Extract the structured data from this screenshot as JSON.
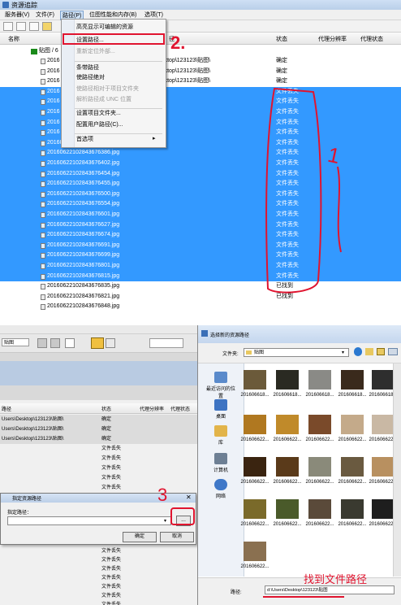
{
  "top_window": {
    "title": "资源追踪",
    "menu": [
      "服务器(V)",
      "文件(F)",
      "路径(P)",
      "位图性能和内存(B)",
      "选项(T)"
    ],
    "columns": {
      "name": "名称",
      "path": "径",
      "status": "状态",
      "proxy_res": "代理分辨率",
      "proxy_status": "代理状态"
    },
    "folder_row": "贴图 / 6",
    "rows": [
      {
        "name": "2016",
        "path": "sers\\Desktop\\123123\\贴图\\",
        "status": "确定",
        "sel": false
      },
      {
        "name": "2016",
        "path": "sers\\Desktop\\123123\\贴图\\",
        "status": "确定",
        "sel": false
      },
      {
        "name": "2016",
        "path": "sers\\Desktop\\123123\\贴图\\",
        "status": "确定",
        "sel": false
      },
      {
        "name": "2016",
        "path": "",
        "status": "文件丢失",
        "sel": true
      },
      {
        "name": "2016",
        "path": "",
        "status": "文件丢失",
        "sel": true
      },
      {
        "name": "2016",
        "path": "",
        "status": "文件丢失",
        "sel": true
      },
      {
        "name": "2016",
        "path": "",
        "status": "文件丢失",
        "sel": true
      },
      {
        "name": "2016",
        "path": "",
        "status": "文件丢失",
        "sel": true
      },
      {
        "name": "20160622102843676358.jpg",
        "path": "",
        "status": "文件丢失",
        "sel": true
      },
      {
        "name": "20160622102843676386.jpg",
        "path": "",
        "status": "文件丢失",
        "sel": true
      },
      {
        "name": "20160622102843676402.jpg",
        "path": "",
        "status": "文件丢失",
        "sel": true
      },
      {
        "name": "20160622102843676454.jpg",
        "path": "",
        "status": "文件丢失",
        "sel": true
      },
      {
        "name": "20160622102843676455.jpg",
        "path": "",
        "status": "文件丢失",
        "sel": true
      },
      {
        "name": "20160622102843676500.jpg",
        "path": "",
        "status": "文件丢失",
        "sel": true
      },
      {
        "name": "20160622102843676554.jpg",
        "path": "",
        "status": "文件丢失",
        "sel": true
      },
      {
        "name": "20160622102843676601.jpg",
        "path": "",
        "status": "文件丢失",
        "sel": true
      },
      {
        "name": "20160622102843676627.jpg",
        "path": "",
        "status": "文件丢失",
        "sel": true
      },
      {
        "name": "20160622102843676674.jpg",
        "path": "",
        "status": "文件丢失",
        "sel": true
      },
      {
        "name": "20160622102843676691.jpg",
        "path": "",
        "status": "文件丢失",
        "sel": true
      },
      {
        "name": "20160622102843676699.jpg",
        "path": "",
        "status": "文件丢失",
        "sel": true
      },
      {
        "name": "20160622102843676801.jpg",
        "path": "",
        "status": "文件丢失",
        "sel": true
      },
      {
        "name": "20160622102843676815.jpg",
        "path": "",
        "status": "文件丢失",
        "sel": true
      },
      {
        "name": "20160622102843676835.jpg",
        "path": "",
        "status": "已找到",
        "sel": false
      },
      {
        "name": "20160622102843676821.jpg",
        "path": "",
        "status": "已找到",
        "sel": false
      },
      {
        "name": "20160622102843676848.jpg",
        "path": "",
        "status": "",
        "sel": false
      }
    ],
    "dropdown": [
      {
        "label": "高亮显示可编辑的资源",
        "dis": false
      },
      {
        "label": "设置路径...",
        "dis": false
      },
      {
        "label": "重新定位外部...",
        "dis": true
      },
      {
        "label": "",
        "sep": true
      },
      {
        "label": "条带路径",
        "dis": false
      },
      {
        "label": "使路径绝对",
        "dis": false
      },
      {
        "label": "使路径相对于项目文件夹",
        "dis": true
      },
      {
        "label": "解析路径成 UNC 位置",
        "dis": true
      },
      {
        "label": "",
        "sep": true
      },
      {
        "label": "设置项目文件夹...",
        "dis": false
      },
      {
        "label": "配置用户路径(C)...",
        "dis": false
      },
      {
        "label": "",
        "sep": true
      },
      {
        "label": "首选项",
        "dis": false,
        "arrow": "▸"
      }
    ],
    "annotations": {
      "step2": "2.",
      "step1": "1"
    }
  },
  "bottom_left": {
    "columns": {
      "path": "路径",
      "status": "状态",
      "proxy_res": "代理分辨率",
      "proxy_status": "代理状态"
    },
    "toolbar_label": "贴图",
    "rows": [
      {
        "path": "Users\\Desktop\\123123\\贴图\\",
        "status": "确定"
      },
      {
        "path": "Users\\Desktop\\123123\\贴图\\",
        "status": "确定"
      },
      {
        "path": "Users\\Desktop\\123123\\贴图\\",
        "status": "确定"
      },
      {
        "path": "",
        "status": "文件丢失"
      },
      {
        "path": "",
        "status": "文件丢失"
      },
      {
        "path": "",
        "status": "文件丢失"
      },
      {
        "path": "",
        "status": "文件丢失"
      },
      {
        "path": "",
        "status": "文件丢失"
      },
      {
        "path": "",
        "status": "文件丢失"
      },
      {
        "path": "",
        "status": "文件丢失"
      },
      {
        "path": "",
        "status": "文件丢失"
      },
      {
        "path": "",
        "status": "文件丢失"
      },
      {
        "path": "",
        "status": "文件丢失"
      },
      {
        "path": "",
        "status": "文件丢失"
      }
    ],
    "dialog": {
      "title": "指定资源路径",
      "label": "指定路径：",
      "browse": "...",
      "ok": "确定",
      "cancel": "取消"
    },
    "step3": "3"
  },
  "file_dialog": {
    "title": "选择新的资源路径",
    "look_in_label": "文件夹:",
    "look_in_value": "贴图",
    "nav": [
      "最近访问的位置",
      "桌面",
      "库",
      "计算机",
      "网络"
    ],
    "thumbs": [
      "201606618...",
      "201606618...",
      "201606618...",
      "201606618...",
      "201606618...",
      "201606622...",
      "201606622...",
      "201606622...",
      "201606622...",
      "201606622...",
      "201606622...",
      "201606622...",
      "201606622...",
      "201606622...",
      "201606622...",
      "201606622...",
      "201606622...",
      "201606622...",
      "201606622...",
      "201606622...",
      "201606622..."
    ],
    "thumb_colors": [
      "#6b5a3a",
      "#2a2a22",
      "#8a8a86",
      "#3a2a1c",
      "#2e2e2e",
      "#b07820",
      "#c08a2a",
      "#7a4a2a",
      "#c4aa8a",
      "#c9b8a4",
      "#3a2410",
      "#5a3a1a",
      "#8a8a7a",
      "#6a5a40",
      "#b89060",
      "#7a6a2a",
      "#4a5a2a",
      "#5a4a3a",
      "#3a3a30",
      "#1e1e1e",
      "#8a7050",
      "#d8c8a8",
      "#6a6a6a",
      "#e0d8cc",
      "#5a4a38",
      "#7a6a3a"
    ],
    "path_label": "路径:",
    "path_value": "d:\\Users\\Desktop\\123123\\贴图",
    "annotation": "找到文件路径"
  }
}
